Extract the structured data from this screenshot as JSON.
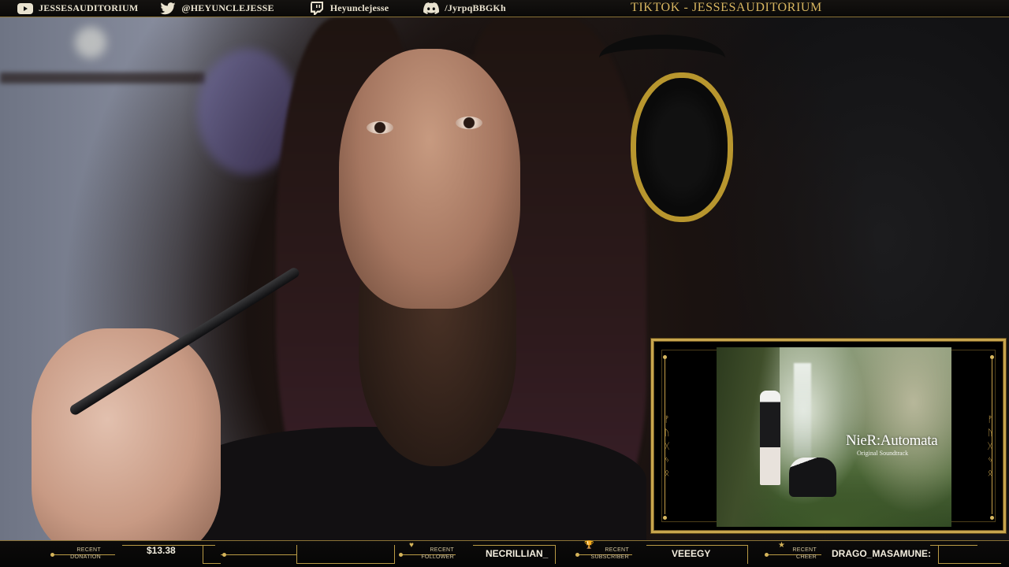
{
  "top_bar": {
    "socials": [
      {
        "icon": "youtube-icon",
        "label": "JESSESAUDITORIUM",
        "color": "#e9e2cf"
      },
      {
        "icon": "twitter-icon",
        "label": "@HEYUNCLEJESSE",
        "color": "#e9e2cf"
      },
      {
        "icon": "twitch-icon",
        "label": "Heyunclejesse",
        "color": "#e9e2cf"
      },
      {
        "icon": "discord-icon",
        "label": "/JyrpqBBGKh",
        "color": "#e9e2cf"
      }
    ],
    "tiktok": "TIKTOK - JESSESAUDITORIUM"
  },
  "now_playing": {
    "album_title": "NieR:Automata",
    "album_subtitle": "Original Soundtrack"
  },
  "bottom_bar": {
    "recent_donation": {
      "label_line1": "RECENT",
      "label_line2": "DONATION",
      "value": "$13.38"
    },
    "recent_follower": {
      "label_line1": "RECENT",
      "label_line2": "FOLLOWER",
      "value": "NECRILLIAN_",
      "icon": "heart-icon"
    },
    "recent_subscriber": {
      "label_line1": "RECENT",
      "label_line2": "SUBSCRIBER",
      "value": "VEEEGY",
      "icon": "trophy-icon"
    },
    "recent_cheer": {
      "label_line1": "RECENT",
      "label_line2": "CHEER",
      "value": "DRAGO_MASAMUNE:",
      "icon": "star-icon"
    }
  },
  "colors": {
    "accent_gold": "#c8a64e",
    "bar_background": "#0a0908",
    "text_light": "#e9e2cf"
  }
}
